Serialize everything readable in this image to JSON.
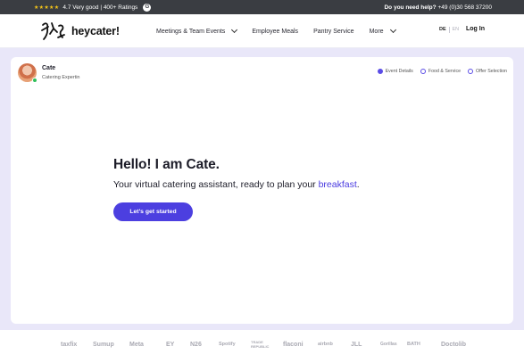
{
  "topbar": {
    "stars": "★★★★★",
    "rating": "4.7 Very good | 400+ Ratings",
    "review_badge": "G",
    "help_label": "Do you need help?",
    "phone": "+49 (0)30 568 37200"
  },
  "nav": {
    "brand": "heycater!",
    "menu": [
      {
        "label": "Meetings & Team Events",
        "has_dropdown": true
      },
      {
        "label": "Employee Meals",
        "has_dropdown": false
      },
      {
        "label": "Pantry Service",
        "has_dropdown": false
      },
      {
        "label": "More",
        "has_dropdown": true
      }
    ],
    "lang_active": "DE",
    "lang_inactive": "EN",
    "login": "Log In"
  },
  "agent": {
    "name": "Cate",
    "role": "Catering Expertin",
    "status": "online"
  },
  "steps": [
    {
      "label": "Event Details",
      "active": true
    },
    {
      "label": "Food & Service",
      "active": false
    },
    {
      "label": "Offer Selection",
      "active": false
    }
  ],
  "hero": {
    "title": "Hello! I am Cate.",
    "subtitle_prefix": "Your virtual catering assistant, ready to plan your ",
    "subtitle_accent": "breakfast",
    "subtitle_suffix": ".",
    "cta": "Let's get started"
  },
  "client_logos": [
    "taxfix",
    "Sumup",
    "Meta",
    "EY",
    "N26",
    "Spotify",
    "TRADE REPUBLIC",
    "flaconi",
    "airbnb",
    "JLL",
    "Gorillas",
    "BATH",
    "Doctolib"
  ],
  "colors": {
    "accent": "#4c3fe0",
    "background": "#e9e7f9",
    "topbar": "#3a3d42"
  }
}
